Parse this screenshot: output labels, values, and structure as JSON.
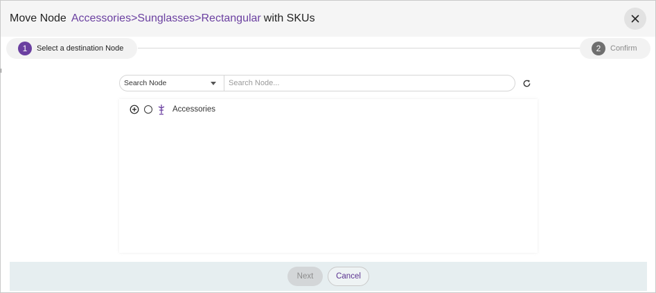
{
  "dialog": {
    "title_prefix": "Move Node",
    "title_path": "Accessories>Sunglasses>Rectangular",
    "title_suffix": "with SKUs",
    "close_icon": "close-icon"
  },
  "stepper": {
    "steps": [
      {
        "number": "1",
        "label": "Select a destination Node",
        "active": true
      },
      {
        "number": "2",
        "label": "Confirm",
        "active": false
      }
    ]
  },
  "search": {
    "select_value": "Search Node",
    "input_placeholder": "Search Node...",
    "input_value": "",
    "refresh_icon": "refresh-icon"
  },
  "tree": {
    "nodes": [
      {
        "label": "Accessories",
        "expand_icon": "plus-circle-icon",
        "node_icon": "node-branch-icon"
      }
    ]
  },
  "footer": {
    "next_label": "Next",
    "cancel_label": "Cancel"
  },
  "colors": {
    "accent": "#6a3fa0",
    "header_bg": "#f5f5f5",
    "footer_bg": "#e6eef0"
  }
}
